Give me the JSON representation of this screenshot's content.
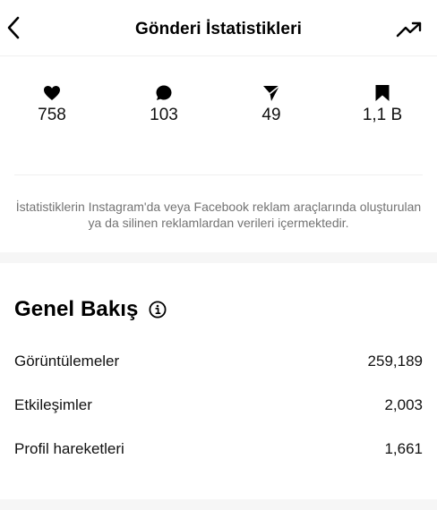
{
  "header": {
    "title": "Gönderi İstatistikleri"
  },
  "stats": {
    "likes": "758",
    "comments": "103",
    "shares": "49",
    "saves": "1,1 B"
  },
  "disclaimer": "İstatistiklerin Instagram'da veya Facebook reklam araçlarında oluşturulan ya da silinen reklamlardan verileri içermektedir.",
  "overview": {
    "title": "Genel Bakış",
    "rows": [
      {
        "label": "Görüntülemeler",
        "value": "259,189"
      },
      {
        "label": "Etkileşimler",
        "value": "2,003"
      },
      {
        "label": "Profil hareketleri",
        "value": "1,661"
      }
    ]
  },
  "icons": {
    "back": "chevron-left-icon",
    "trend": "trending-up-icon",
    "likes": "heart-icon",
    "comments": "comment-bubble-icon",
    "shares": "send-icon",
    "saves": "bookmark-icon",
    "info": "info-icon"
  },
  "colors": {
    "text": "#000000",
    "secondary": "#737373",
    "divider": "#efefef",
    "section_bg": "#f6f6f6"
  }
}
